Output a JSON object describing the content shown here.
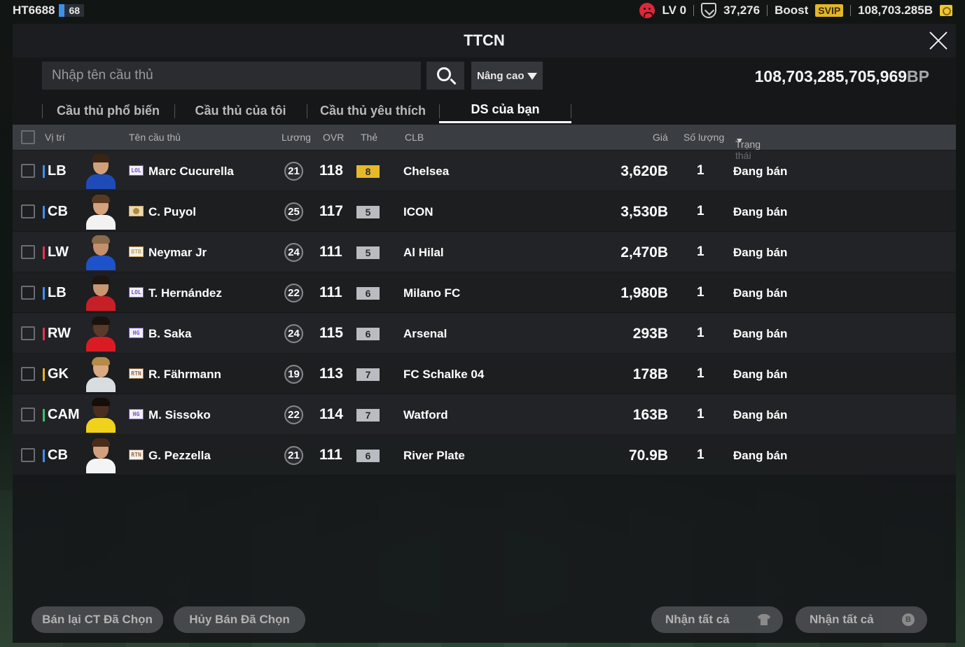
{
  "topbar": {
    "username": "HT6688",
    "user_level": "68",
    "lv_label": "LV 0",
    "trophy_count": "37,276",
    "boost_label": "Boost",
    "svip_label": "SVIP",
    "coin_balance": "108,703.285B"
  },
  "panel": {
    "title": "TTCN"
  },
  "search": {
    "placeholder": "Nhập tên cầu thủ",
    "advanced_label": "Nâng cao"
  },
  "balance": {
    "amount": "108,703,285,705,969",
    "unit": "BP"
  },
  "tabs": [
    {
      "label": "Cầu thủ phổ biến",
      "active": false
    },
    {
      "label": "Cầu thủ của tôi",
      "active": false
    },
    {
      "label": "Cầu thủ yêu thích",
      "active": false
    },
    {
      "label": "DS của bạn",
      "active": true
    }
  ],
  "columns": {
    "position": "Vị trí",
    "name": "Tên cầu thủ",
    "salary": "Lương",
    "ovr": "OVR",
    "card": "Thẻ",
    "club": "CLB",
    "price": "Giá",
    "quantity": "Số lượng",
    "status": "Trạng thái"
  },
  "colors": {
    "pos_defender": "#3f8ff0",
    "pos_attacker": "#e2354a",
    "pos_gk": "#e0b22a",
    "pos_mid": "#3fbf6a",
    "grade_gold": "#e7b92a",
    "grade_silver": "#b9bcc0"
  },
  "players": [
    {
      "position": "LB",
      "pos_color": "#3f8ff0",
      "season": "LOL",
      "name": "Marc Cucurella",
      "salary": "21",
      "ovr": "118",
      "grade": "8",
      "grade_color": "#e7b92a",
      "club": "Chelsea",
      "price": "3,620B",
      "quantity": "1",
      "status": "Đang bán",
      "kit": "#1f4bb8",
      "skin": "#d1a07a",
      "hair": "#3a2414"
    },
    {
      "position": "CB",
      "pos_color": "#3f8ff0",
      "season": "icon",
      "name": "C. Puyol",
      "salary": "25",
      "ovr": "117",
      "grade": "5",
      "grade_color": "#b9bcc0",
      "club": "ICON",
      "price": "3,530B",
      "quantity": "1",
      "status": "Đang bán",
      "kit": "#f2f2f2",
      "skin": "#d4a27c",
      "hair": "#5a3a1f"
    },
    {
      "position": "LW",
      "pos_color": "#e2354a",
      "season": "BTB",
      "name": "Neymar Jr",
      "salary": "24",
      "ovr": "111",
      "grade": "5",
      "grade_color": "#b9bcc0",
      "club": "Al Hilal",
      "price": "2,470B",
      "quantity": "1",
      "status": "Đang bán",
      "kit": "#1e52c8",
      "skin": "#c48f6c",
      "hair": "#8a6a4a"
    },
    {
      "position": "LB",
      "pos_color": "#3f8ff0",
      "season": "LOL",
      "name": "T. Hernández",
      "salary": "22",
      "ovr": "111",
      "grade": "6",
      "grade_color": "#b9bcc0",
      "club": "Milano FC",
      "price": "1,980B",
      "quantity": "1",
      "status": "Đang bán",
      "kit": "#c71f26",
      "skin": "#c8966f",
      "hair": "#1e1410"
    },
    {
      "position": "RW",
      "pos_color": "#e2354a",
      "season": "HG",
      "name": "B. Saka",
      "salary": "24",
      "ovr": "115",
      "grade": "6",
      "grade_color": "#b9bcc0",
      "club": "Arsenal",
      "price": "293B",
      "quantity": "1",
      "status": "Đang bán",
      "kit": "#d91c24",
      "skin": "#5a3a28",
      "hair": "#1a120c"
    },
    {
      "position": "GK",
      "pos_color": "#e0b22a",
      "season": "RTN",
      "name": "R. Fährmann",
      "salary": "19",
      "ovr": "113",
      "grade": "7",
      "grade_color": "#b9bcc0",
      "club": "FC Schalke 04",
      "price": "178B",
      "quantity": "1",
      "status": "Đang bán",
      "kit": "#d8dde0",
      "skin": "#d9a982",
      "hair": "#b78a4a"
    },
    {
      "position": "CAM",
      "pos_color": "#3fbf6a",
      "season": "HG",
      "name": "M. Sissoko",
      "salary": "22",
      "ovr": "114",
      "grade": "7",
      "grade_color": "#b9bcc0",
      "club": "Watford",
      "price": "163B",
      "quantity": "1",
      "status": "Đang bán",
      "kit": "#f0d21c",
      "skin": "#4a2e20",
      "hair": "#140e0a"
    },
    {
      "position": "CB",
      "pos_color": "#3f8ff0",
      "season": "RTN",
      "name": "G. Pezzella",
      "salary": "21",
      "ovr": "111",
      "grade": "6",
      "grade_color": "#b9bcc0",
      "club": "River Plate",
      "price": "70.9B",
      "quantity": "1",
      "status": "Đang bán",
      "kit": "#f4f4f4",
      "skin": "#d2a07c",
      "hair": "#4a2c18"
    }
  ],
  "footer": {
    "resell_selected": "Bán lại CT Đã Chọn",
    "cancel_selected": "Hủy Bán Đã Chọn",
    "claim_all_items": "Nhận tất cả",
    "claim_all_bp": "Nhận tất cả"
  }
}
